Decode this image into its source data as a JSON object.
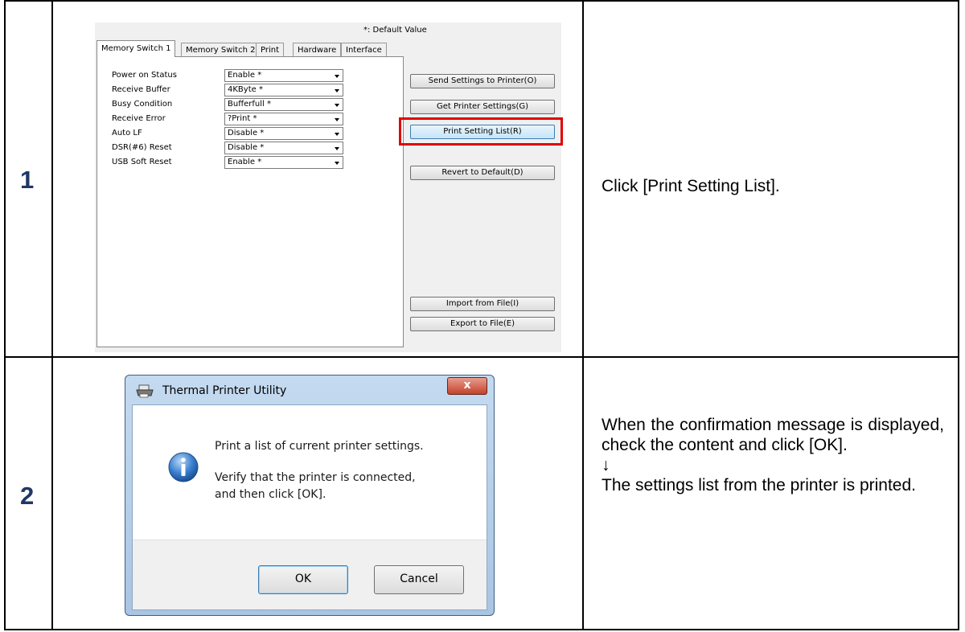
{
  "steps": [
    {
      "number": "1",
      "description": "Click [Print Setting List]."
    },
    {
      "number": "2",
      "description_lines": [
        "When the confirmation message is displayed, check the content and click [OK].",
        "↓",
        "The settings list from the printer is printed."
      ]
    }
  ],
  "settings_panel": {
    "default_note": "*: Default Value",
    "tabs": [
      "Memory Switch 1",
      "Memory Switch 2",
      "Print",
      "Hardware",
      "Interface"
    ],
    "active_tab": "Memory Switch 1",
    "settings": [
      {
        "label": "Power on Status",
        "value": "Enable *"
      },
      {
        "label": "Receive Buffer",
        "value": "4KByte *"
      },
      {
        "label": "Busy Condition",
        "value": "Bufferfull *"
      },
      {
        "label": "Receive Error",
        "value": "?Print *"
      },
      {
        "label": "Auto LF",
        "value": "Disable *"
      },
      {
        "label": "DSR(#6) Reset",
        "value": "Disable *"
      },
      {
        "label": "USB Soft Reset",
        "value": "Enable *"
      }
    ],
    "buttons": {
      "send": "Send Settings to Printer(O)",
      "get": "Get Printer Settings(G)",
      "print_list": "Print Setting List(R)",
      "revert": "Revert to Default(D)",
      "import": "Import from File(I)",
      "export": "Export to File(E)"
    },
    "highlight_color": "#e00000"
  },
  "dialog": {
    "title": "Thermal Printer Utility",
    "message_line1": "Print a list of current printer settings.",
    "message_line2": "Verify that the printer is connected,",
    "message_line3": "and then click [OK].",
    "ok_label": "OK",
    "cancel_label": "Cancel",
    "close_label": "x",
    "icons": [
      "printer-icon",
      "info-icon",
      "close-icon"
    ]
  },
  "colors": {
    "step_number": "#1f3864",
    "highlight": "#e00000"
  }
}
